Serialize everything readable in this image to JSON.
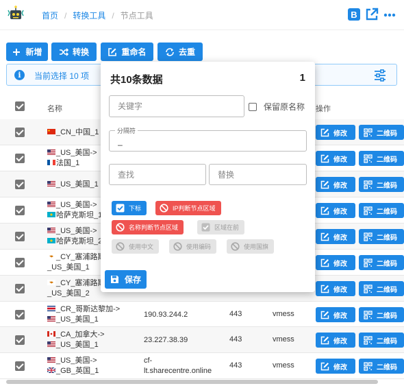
{
  "breadcrumb": {
    "home": "首页",
    "tools": "转换工具",
    "current": "节点工具"
  },
  "toolbar": {
    "add": "新增",
    "convert": "转换",
    "rename": "重命名",
    "dedupe": "去重"
  },
  "info": {
    "text": "当前选择 10 项"
  },
  "table": {
    "headers": {
      "name": "名称",
      "actions": "操作"
    },
    "edit_label": "修改",
    "qr_label": "二维码",
    "rows": [
      {
        "name_lines": [
          "_CN_中国_1"
        ],
        "flags": [
          "cn"
        ],
        "address": "",
        "port": "",
        "protocol": ""
      },
      {
        "name_lines": [
          "_US_美国->",
          "法国_1"
        ],
        "flags": [
          "us",
          "fr"
        ],
        "address": "",
        "port": "",
        "protocol": ""
      },
      {
        "name_lines": [
          "_US_美国_1"
        ],
        "flags": [
          "us"
        ],
        "address": "",
        "port": "",
        "protocol": ""
      },
      {
        "name_lines": [
          "_US_美国->",
          "哈萨克斯坦_1"
        ],
        "flags": [
          "us",
          "kz"
        ],
        "address": "",
        "port": "",
        "protocol": ""
      },
      {
        "name_lines": [
          "_US_美国->",
          "哈萨克斯坦_2"
        ],
        "flags": [
          "us",
          "kz"
        ],
        "address": "",
        "port": "",
        "protocol": ""
      },
      {
        "name_lines": [
          "_CY_塞浦路斯",
          "_US_美国_1"
        ],
        "flags": [
          "cy"
        ],
        "address": "",
        "port": "",
        "protocol": ""
      },
      {
        "name_lines": [
          "_CY_塞浦路斯",
          "_US_美国_2"
        ],
        "flags": [
          "cy"
        ],
        "address": "",
        "port": "",
        "protocol": ""
      },
      {
        "name_lines": [
          "_CR_哥斯达黎加->",
          "_US_美国_1"
        ],
        "flags": [
          "cr",
          "us"
        ],
        "address": "190.93.244.2",
        "port": "443",
        "protocol": "vmess"
      },
      {
        "name_lines": [
          "_CA_加拿大->",
          "_US_美国_1"
        ],
        "flags": [
          "ca",
          "us"
        ],
        "address": "23.227.38.39",
        "port": "443",
        "protocol": "vmess"
      },
      {
        "name_lines": [
          "_US_美国->",
          "_GB_英国_1"
        ],
        "flags": [
          "us",
          "gb"
        ],
        "address_lines": [
          "cf-",
          "lt.sharecentre.online"
        ],
        "port": "443",
        "protocol": "vmess"
      }
    ]
  },
  "popup": {
    "title": "共10条数据",
    "count": "1",
    "keyword_placeholder": "关键字",
    "keep_original": "保留原名称",
    "separator_label": "分隔符",
    "separator_value": "_",
    "find_placeholder": "查找",
    "replace_placeholder": "替换",
    "chips": {
      "index": "下标",
      "ip_region": "IP判断节点区域",
      "name_region": "名称判断节点区域",
      "region_first": "区域在前",
      "use_chinese": "使用中文",
      "use_code": "使用编码",
      "use_flag": "使用国旗"
    },
    "save": "保存"
  },
  "colors": {
    "primary": "#1e88e5",
    "danger": "#ef5350",
    "disabled": "#e4e4e4"
  }
}
